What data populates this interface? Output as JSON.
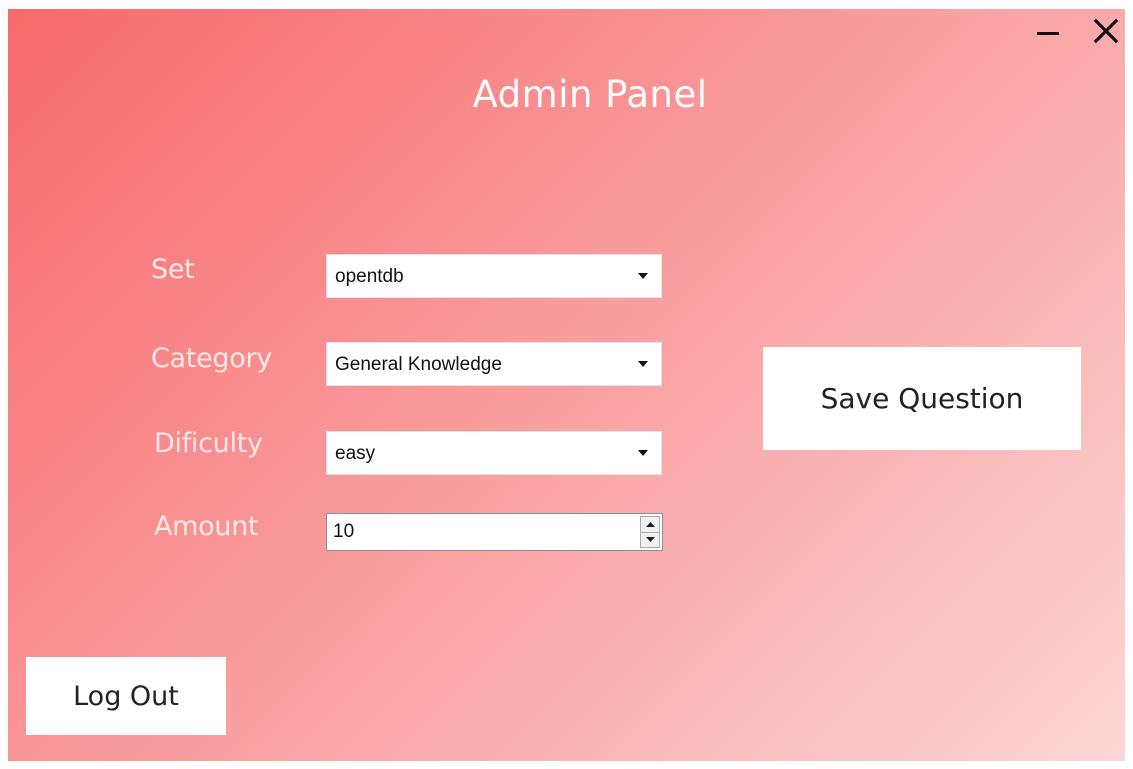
{
  "window": {
    "title": "Admin Panel",
    "minimize_icon": "minimize-icon",
    "close_icon": "close-icon"
  },
  "form": {
    "set": {
      "label": "Set",
      "value": "opentdb"
    },
    "category": {
      "label": "Category",
      "value": "General Knowledge"
    },
    "difficulty": {
      "label": "Dificulty",
      "value": "easy"
    },
    "amount": {
      "label": "Amount",
      "value": "10"
    }
  },
  "buttons": {
    "save_label": "Save Question",
    "logout_label": "Log Out"
  },
  "colors": {
    "gradient_start": "#f86a6b",
    "gradient_end": "#fcd6d6",
    "label_text": "#fde8e8",
    "button_bg": "#ffffff"
  }
}
